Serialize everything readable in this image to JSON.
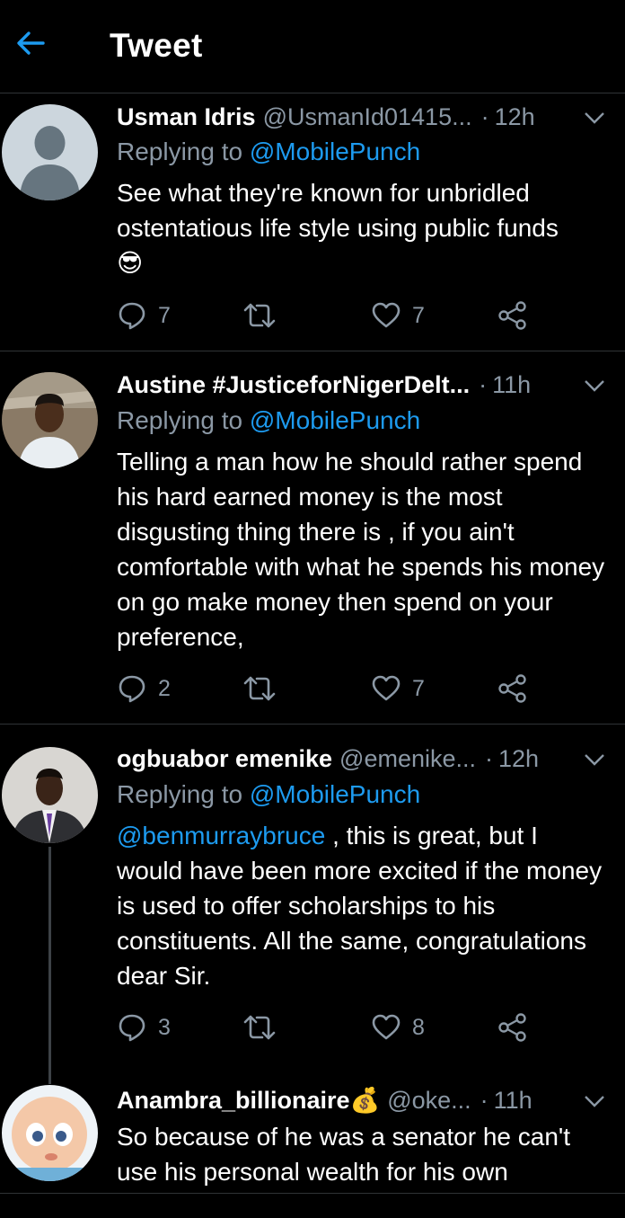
{
  "header": {
    "title": "Tweet",
    "back_icon": "back-arrow-icon"
  },
  "colors": {
    "accent": "#1d9bf0",
    "muted": "#8b98a5",
    "divider": "#2f3336",
    "background": "#000000"
  },
  "tweets": [
    {
      "name": "Usman Idris",
      "handle": "@UsmanId01415...",
      "time": "12h",
      "replying_label": "Replying to ",
      "replying_to": "@MobilePunch",
      "text": "See what they're known for unbridled ostentatious life style using public funds",
      "emoji": "😎",
      "replies": "7",
      "retweets": "",
      "likes": "7"
    },
    {
      "name": "Austine #JusticeforNigerDelt...",
      "handle": "",
      "time": "11h",
      "replying_label": "Replying to ",
      "replying_to": "@MobilePunch",
      "text": "Telling a man how he should rather spend his hard earned money is the most disgusting thing there is , if you ain't comfortable with what he spends his money on go make money then spend on your preference,",
      "replies": "2",
      "retweets": "",
      "likes": "7"
    },
    {
      "name": "ogbuabor emenike",
      "handle": "@emenike...",
      "time": "12h",
      "replying_label": "Replying to ",
      "replying_to": "@MobilePunch",
      "text_mention": "@benmurraybruce",
      "text": " , this is great, but I would have been more excited if the money is used to offer scholarships to his constituents. All the same, congratulations dear Sir.",
      "replies": "3",
      "retweets": "",
      "likes": "8"
    },
    {
      "name": "Anambra_billionaire",
      "name_emoji": "💰",
      "handle": "@oke...",
      "time": "11h",
      "text": "So because of he was a senator he can't use his personal wealth for his own"
    }
  ],
  "separator": "·"
}
